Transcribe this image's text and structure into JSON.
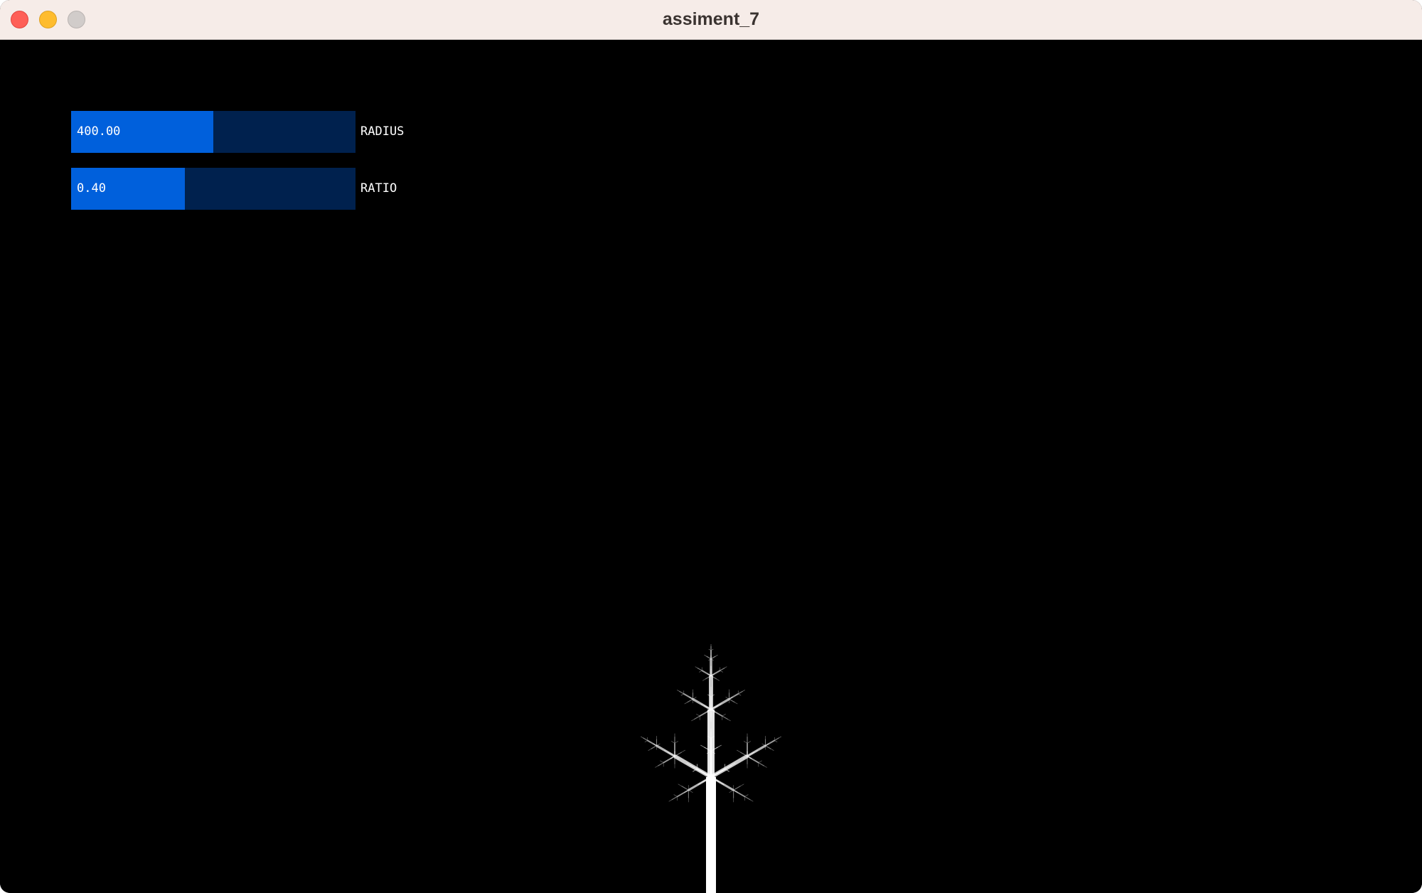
{
  "window": {
    "title": "assiment_7"
  },
  "controls": {
    "radius": {
      "label": "RADIUS",
      "value_text": "400.00",
      "fill_fraction": 0.5
    },
    "ratio": {
      "label": "RATIO",
      "value_text": "0.40",
      "fill_fraction": 0.4
    }
  },
  "colors": {
    "background": "#000000",
    "slider_fill": "#0060dc",
    "slider_track": "#00214e",
    "tree": "#ffffff"
  },
  "scene": {
    "type": "fractal-tree",
    "depth": 6,
    "branch_ratio": 0.4
  }
}
